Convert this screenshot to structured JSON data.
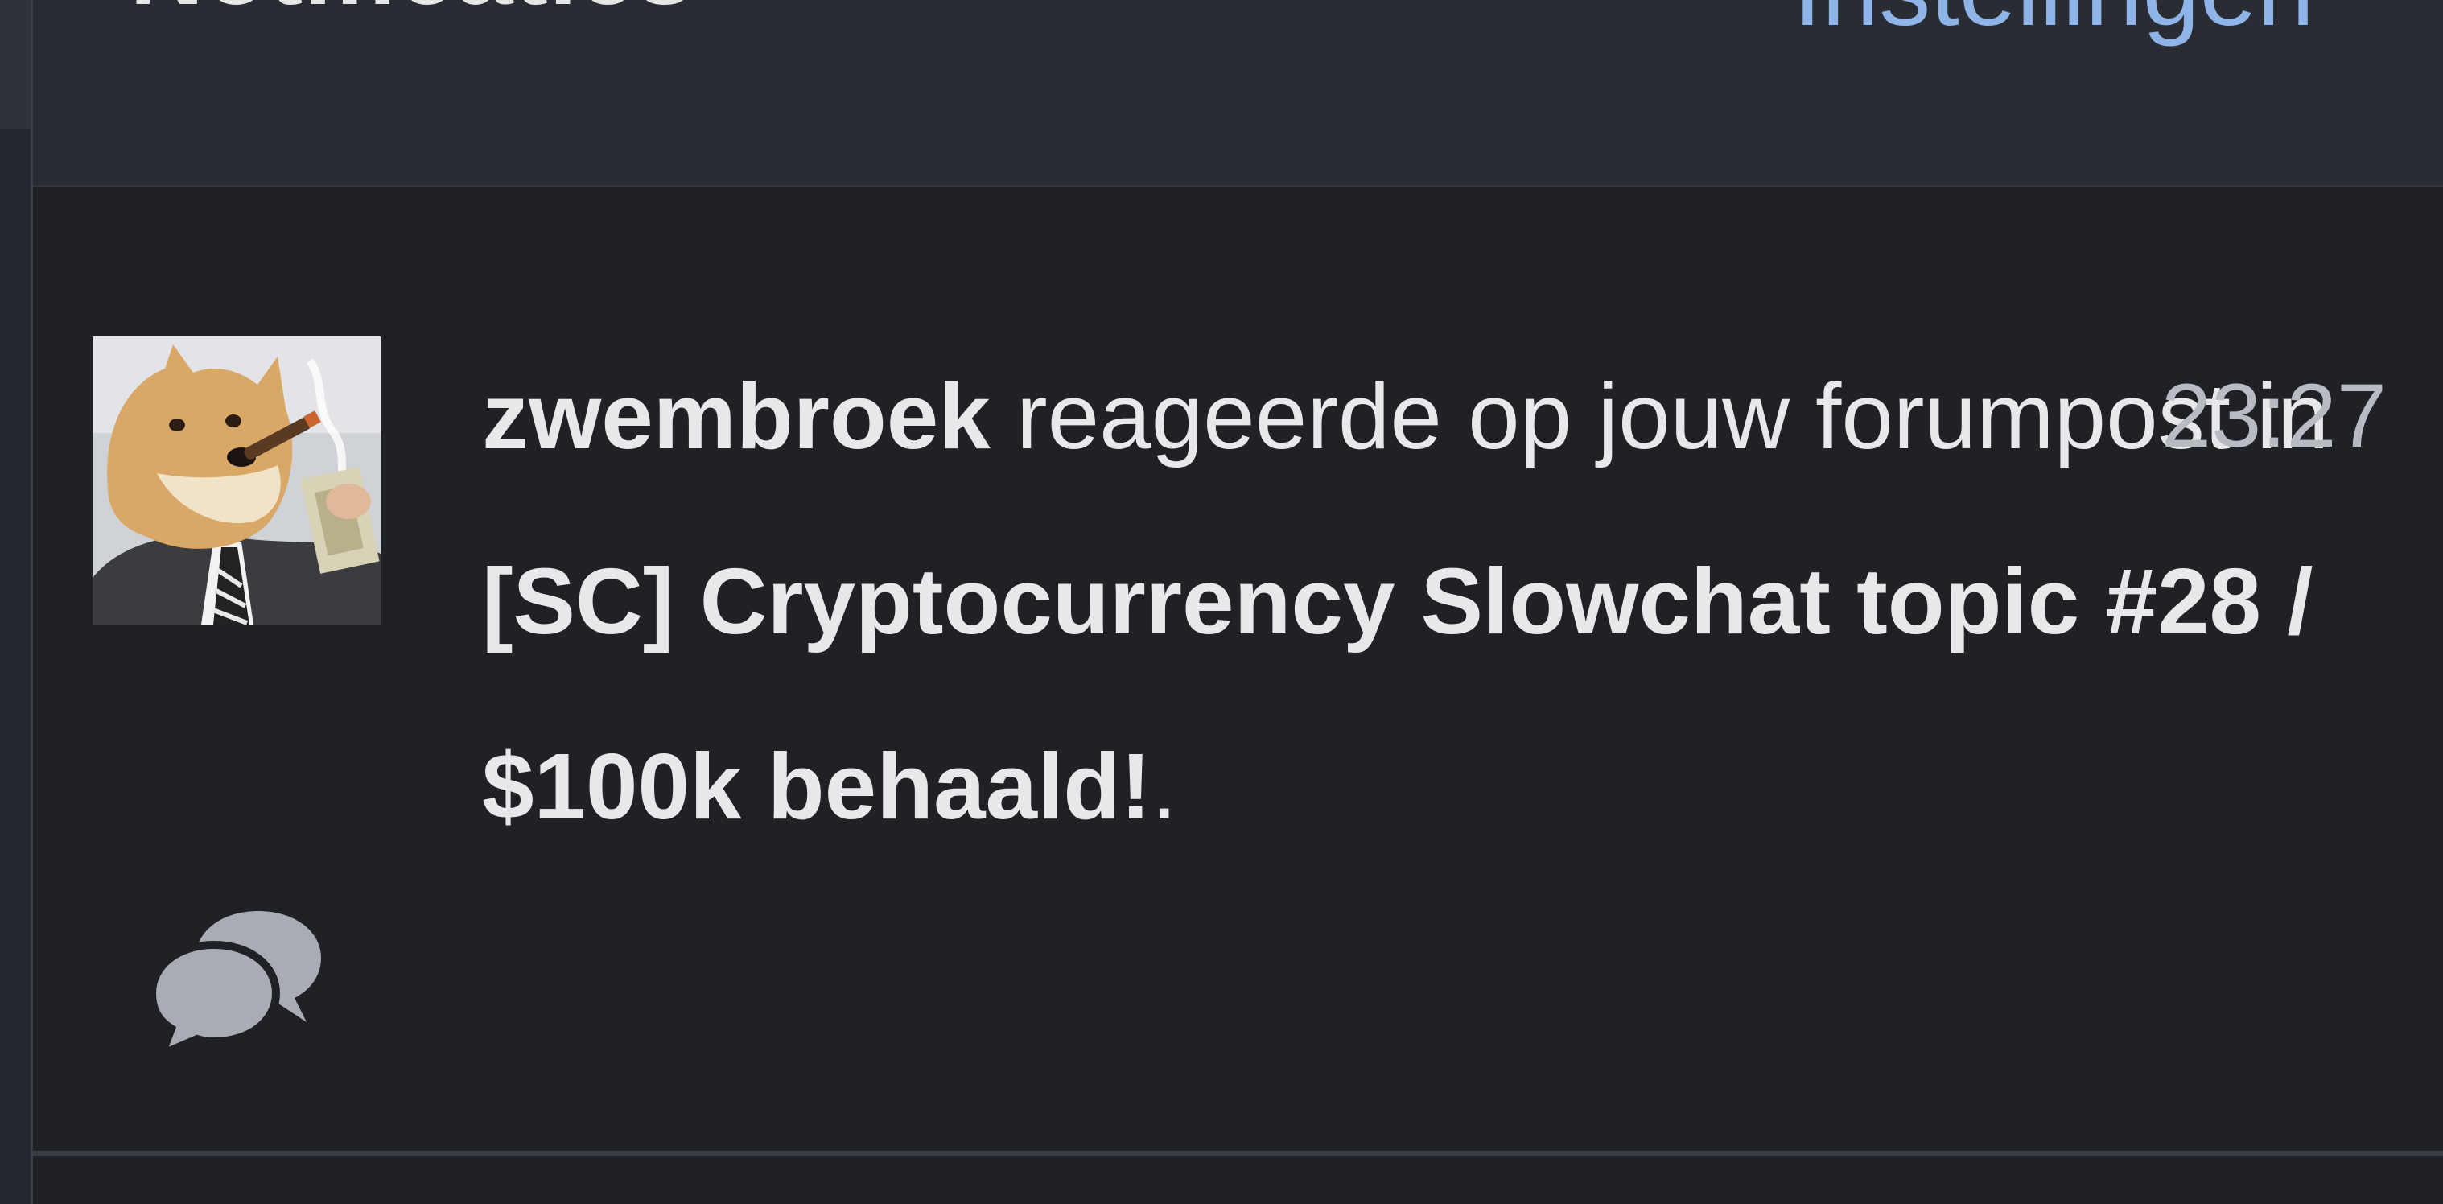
{
  "header": {
    "title": "Notificaties",
    "settings_label": "Instellingen"
  },
  "notification": {
    "username": "zwembroek",
    "action_text": " reageerde op jouw forumpost in ",
    "topic": "[SC] Cryptocurrency Slowchat topic #28 / $100k behaald!",
    "trailing": ".",
    "time": "23:27",
    "avatar_icon": "doge-avatar",
    "type_icon": "chat-bubbles-icon"
  },
  "colors": {
    "background": "#1f2126",
    "header_background": "#292c32",
    "text": "#e8e8ea",
    "link": "#8fb4e8",
    "time": "#b7bcc3",
    "icon": "#a9adb3"
  }
}
